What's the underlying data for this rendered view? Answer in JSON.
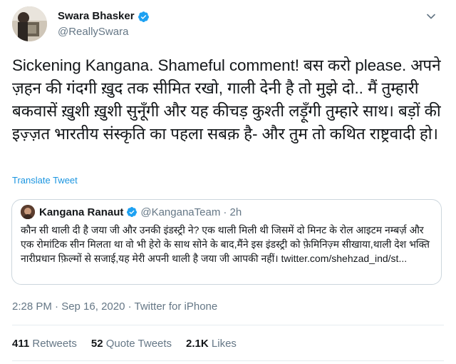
{
  "author": {
    "name": "Swara Bhasker",
    "handle": "@ReallySwara"
  },
  "tweet": {
    "text": "Sickening Kangana. Shameful comment! बस करो please. अपने ज़हन की गंदगी ख़ुद तक सीमित रखो, गाली देनी है तो मुझे दो.. मैं तुम्हारी बकवासें ख़ुशी ख़ुशी सुनूँगी और यह कीचड़ कुश्ती लड़ूँगी तुम्हारे साथ। बड़ों की इज़्ज़त भारतीय संस्कृति का पहला सबक़ है- और तुम तो कथित राष्ट्रवादी हो।",
    "translate_label": "Translate Tweet",
    "timestamp": "2:28 PM · Sep 16, 2020 · Twitter for iPhone"
  },
  "quoted": {
    "name": "Kangana Ranaut",
    "handle": "@KanganaTeam",
    "time": "· 2h",
    "text": "कौन सी थाली दी है जया जी और उनकी इंडस्ट्री ने? एक थाली मिली थी जिसमें दो मिनट के रोल आइटम नम्बर्ज़ और एक रोमांटिक सीन मिलता था वो भी हेरो के साथ सोने के बाद,मैंने इस इंडस्ट्री को फ़ेमिनिज़्म सीखाया,थाली देश भक्ति नारीप्रधान फ़िल्मों से सजाई,यह मेरी अपनी थाली है जया जी आपकी नहीं। twitter.com/shehzad_ind/st..."
  },
  "stats": {
    "retweets_count": "411",
    "retweets_label": "Retweets",
    "quotes_count": "52",
    "quotes_label": "Quote Tweets",
    "likes_count": "2.1K",
    "likes_label": "Likes"
  },
  "colors": {
    "link": "#1b95e0",
    "verified": "#1da1f2",
    "muted": "#657786"
  }
}
